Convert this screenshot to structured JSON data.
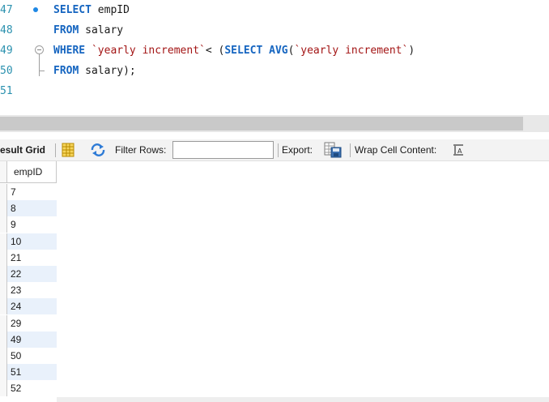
{
  "editor": {
    "lines": [
      {
        "number": "47",
        "has_exec_dot": true,
        "tokens": [
          {
            "text": "SELECT",
            "kind": "kw"
          },
          {
            "text": " empID",
            "kind": "plain"
          }
        ]
      },
      {
        "number": "48",
        "tokens": [
          {
            "text": "FROM",
            "kind": "kw"
          },
          {
            "text": " salary",
            "kind": "plain"
          }
        ]
      },
      {
        "number": "49",
        "has_fold": true,
        "tokens": [
          {
            "text": "WHERE",
            "kind": "kw"
          },
          {
            "text": " ",
            "kind": "plain"
          },
          {
            "text": "`yearly increment`",
            "kind": "str"
          },
          {
            "text": "< (",
            "kind": "plain"
          },
          {
            "text": "SELECT",
            "kind": "kw"
          },
          {
            "text": " ",
            "kind": "plain"
          },
          {
            "text": "AVG",
            "kind": "fn"
          },
          {
            "text": "(",
            "kind": "plain"
          },
          {
            "text": "`yearly increment`",
            "kind": "str"
          },
          {
            "text": ")",
            "kind": "plain"
          }
        ]
      },
      {
        "number": "50",
        "has_fold_end": true,
        "tokens": [
          {
            "text": "FROM",
            "kind": "kw"
          },
          {
            "text": " salary);",
            "kind": "plain"
          }
        ]
      },
      {
        "number": "51",
        "tokens": []
      }
    ]
  },
  "toolbar": {
    "result_grid_label": "esult Grid",
    "grid_icon": "grid-view-icon",
    "refresh_icon": "refresh-icon",
    "filter_label": "Filter Rows:",
    "filter_value": "",
    "export_label": "Export:",
    "export_icon": "export-icon",
    "wrap_label": "Wrap Cell Content:",
    "wrap_icon": "wrap-cell-icon"
  },
  "grid": {
    "columns": [
      "empID"
    ],
    "rows": [
      "7",
      "8",
      "9",
      "10",
      "21",
      "22",
      "23",
      "24",
      "29",
      "49",
      "50",
      "51",
      "52"
    ]
  },
  "colors": {
    "keyword": "#1565c0",
    "string": "#a31515",
    "line_number": "#2b91af",
    "alt_row": "#e9f1fb"
  }
}
